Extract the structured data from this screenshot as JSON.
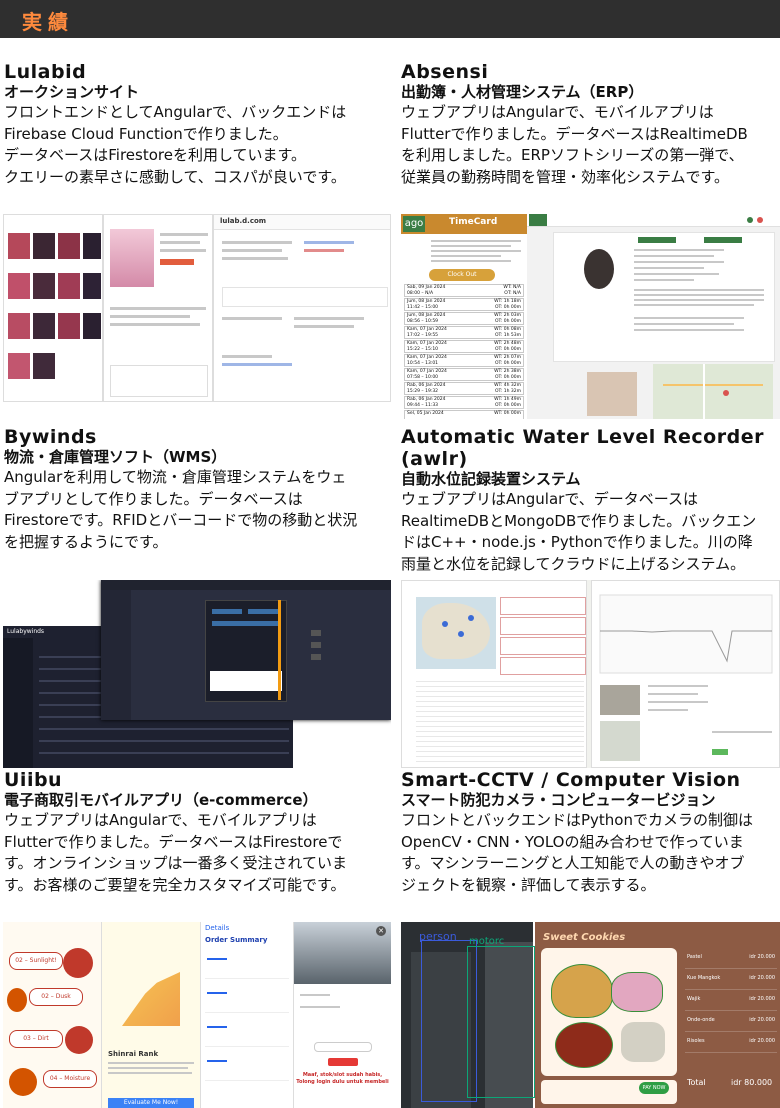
{
  "header": {
    "title": "実績"
  },
  "projects": [
    {
      "name": "Lulabid",
      "subtitle": "オークションサイト",
      "description": [
        "フロントエンドとしてAngularで、バックエンドは",
        "Firebase Cloud Functionで作りました。",
        "データベースはFirestoreを利用しています。",
        "クエリーの素早さに感動して、コスパが良いです。"
      ]
    },
    {
      "name": "Absensi",
      "subtitle": "出勤簿・人材管理システム（ERP）",
      "description": [
        "ウェブアプリはAngularで、モバイルアプリは",
        "Flutterで作りました。データベースはRealtimeDB",
        "を利用しました。ERPソフトシリーズの第一弾で、",
        "従業員の勤務時間を管理・効率化システムです。"
      ]
    },
    {
      "name": "Bywinds",
      "subtitle": "物流・倉庫管理ソフト（WMS）",
      "description": [
        "Angularを利用して物流・倉庫管理システムをウェ",
        "ブアプリとして作りました。データベースは",
        "Firestoreです。RFIDとバーコードで物の移動と状況",
        "を把握するようにです。"
      ]
    },
    {
      "name": "Automatic Water Level Recorder (awlr)",
      "subtitle": "自動水位記録装置システム",
      "description": [
        "ウェブアプリはAngularで、データベースは",
        "RealtimeDBとMongoDBで作りました。バックエン",
        "ドはC++・node.js・Pythonで作りました。川の降",
        "雨量と水位を記録してクラウドに上げるシステム。"
      ]
    },
    {
      "name": "Uiibu",
      "subtitle": "電子商取引モバイルアプリ（e-commerce）",
      "description": [
        "ウェブアプリはAngularで、モバイルアプリは",
        "Flutterで作りました。データベースはFirestoreで",
        "す。オンラインショップは一番多く受注されていま",
        "す。お客様のご要望を完全カスタマイズ可能です。"
      ]
    },
    {
      "name": "Smart-CCTV / Computer Vision",
      "subtitle": "スマート防犯カメラ・コンピュータービジョン",
      "description": [
        "フロントとバックエンドはPythonでカメラの制御は",
        "OpenCV・CNN・YOLOの組み合わせで作っていま",
        "す。マシンラーニングと人工知能で人の動きやオブ",
        "ジェクトを観察・評価して表示する。"
      ]
    }
  ],
  "screenshots": {
    "lulabid_logo": "lulab.d.com",
    "absensi_title": "TimeCard",
    "absensi_button": "Clock Out",
    "absensi_logo": "ago",
    "absensi_rows": [
      {
        "day": "Sab, 09 Jan 2024",
        "time": "08:00 – N/A",
        "wt": "WT: N/A",
        "ot": "OT: N/A"
      },
      {
        "day": "Jum, 08 Jan 2024",
        "time": "11:42 – 15:00",
        "wt": "WT: 1h 18m",
        "ot": "OT: 0h 00m"
      },
      {
        "day": "Jum, 08 Jan 2024",
        "time": "08:56 – 10:59",
        "wt": "WT: 2h 03m",
        "ot": "OT: 0h 00m"
      },
      {
        "day": "Kam, 07 Jan 2024",
        "time": "17:02 – 19:55",
        "wt": "WT: 0h 08m",
        "ot": "OT: 1h 53m"
      },
      {
        "day": "Kam, 07 Jan 2024",
        "time": "15:22 – 15:10",
        "wt": "WT: 2h 48m",
        "ot": "OT: 0h 00m"
      },
      {
        "day": "Kam, 07 Jan 2024",
        "time": "10:54 – 13:01",
        "wt": "WT: 2h 07m",
        "ot": "OT: 0h 00m"
      },
      {
        "day": "Kam, 07 Jan 2024",
        "time": "07:58 – 10:00",
        "wt": "WT: 2h 38m",
        "ot": "OT: 0h 00m"
      },
      {
        "day": "Rab, 06 Jan 2024",
        "time": "15:29 – 19:32",
        "wt": "WT: 4h 32m",
        "ot": "OT: 1h 32m"
      },
      {
        "day": "Rab, 06 Jan 2024",
        "time": "09:44 – 11:33",
        "wt": "WT: 1h 49m",
        "ot": "OT: 0h 00m"
      },
      {
        "day": "Sel, 05 Jan 2024",
        "time": "",
        "wt": "WT: 0h 00m",
        "ot": ""
      }
    ],
    "bywinds_logo": "Lulabywinds",
    "uiibu_cards": [
      "02 – Sunlight!",
      "02 – Dusk",
      "03 – Dirt",
      "04 – Moisture"
    ],
    "uiibu_rank_title": "Shinrai Rank",
    "uiibu_button": "Evaluate Me Now!",
    "uiibu_order": "Order Summary",
    "uiibu_details": "Details",
    "uiibu_sell_text": [
      "Maaf, stok/slot sudah habis,",
      "Tolong login dulu untuk membeli"
    ],
    "cctv_labels": [
      "person",
      "motorc"
    ],
    "cookies_title": "Sweet Cookies",
    "cookies_total_label": "Total",
    "cookies_total": "idr 80.000",
    "cookies_pay": "PAY NOW",
    "cookies_items": [
      {
        "name": "Pastel",
        "price": "idr 20.000"
      },
      {
        "name": "Kue Mangkok",
        "price": "idr 20.000"
      },
      {
        "name": "Wajik",
        "price": "idr 20.000"
      },
      {
        "name": "Onde-onde",
        "price": "idr 20.000"
      },
      {
        "name": "Risoles",
        "price": "idr 20.000"
      }
    ]
  }
}
